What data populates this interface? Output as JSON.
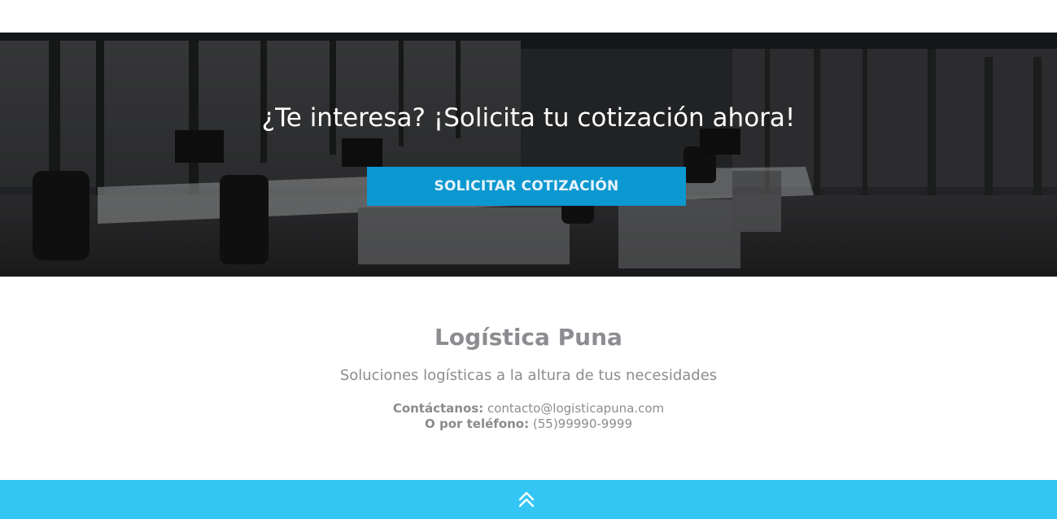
{
  "hero": {
    "title": "¿Te interesa? ¡Solicita tu cotización ahora!",
    "button_label": "SOLICITAR COTIZACIÓN",
    "background_image": "office-interior-photo"
  },
  "footer": {
    "brand": "Logística Puna",
    "tagline": "Soluciones logísticas a la altura de tus necesidades",
    "contact_label": "Contáctanos:",
    "contact_email": "contacto@logisticapuna.com",
    "phone_label": "O por teléfono:",
    "phone_number": "(55)99990-9999"
  },
  "bottom_bar": {
    "icon": "double-chevron-up-icon"
  },
  "colors": {
    "button": "#0b98d0",
    "bottom_bar": "#33c6f4",
    "footer_text": "#8c8d90"
  }
}
